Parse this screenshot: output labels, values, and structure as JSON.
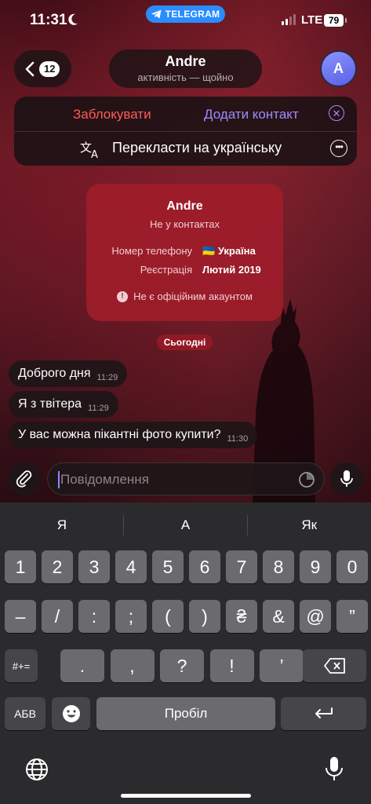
{
  "status_bar": {
    "time": "11:31",
    "app_pill": "TELEGRAM",
    "network": "LTE",
    "battery": "79"
  },
  "header": {
    "back_count": "12",
    "contact_name": "Andre",
    "activity": "активність — щойно",
    "avatar_letter": "A"
  },
  "action_panel": {
    "block_label": "Заблокувати",
    "add_contact_label": "Додати контакт",
    "translate_label": "Перекласти на українську"
  },
  "info_card": {
    "name": "Andre",
    "subtitle": "Не у контактах",
    "phone_label": "Номер телефону",
    "phone_value": "Україна",
    "flag": "🇺🇦",
    "registration_label": "Реєстрація",
    "registration_value": "Лютий 2019",
    "note": "Не є офіційним акаунтом"
  },
  "date_chip": "Сьогодні",
  "messages": [
    {
      "text": "Доброго дня",
      "time": "11:29"
    },
    {
      "text": "Я з твітера",
      "time": "11:29"
    },
    {
      "text": "У вас можна пікантні фото купити?",
      "time": "11:30"
    }
  ],
  "composer": {
    "placeholder": "Повідомлення"
  },
  "keyboard": {
    "suggestions": [
      "Я",
      "А",
      "Як"
    ],
    "row1": [
      "1",
      "2",
      "3",
      "4",
      "5",
      "6",
      "7",
      "8",
      "9",
      "0"
    ],
    "row2": [
      "–",
      "/",
      ":",
      ";",
      "(",
      ")",
      "₴",
      "&",
      "@",
      "”"
    ],
    "row3_left": "#+=",
    "row3": [
      ".",
      ",",
      "?",
      "!",
      "’"
    ],
    "abc_label": "АБВ",
    "space_label": "Пробіл"
  },
  "colors": {
    "accent": "#a18bff",
    "danger": "#ff5a5a",
    "telegram_blue": "#2a8cff",
    "card_red": "#a01c2a"
  }
}
